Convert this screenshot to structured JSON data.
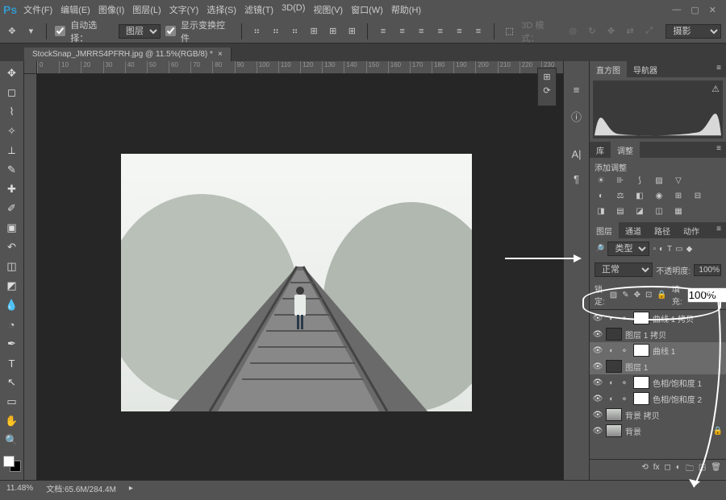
{
  "app": {
    "logo": "Ps"
  },
  "menu": [
    "文件(F)",
    "编辑(E)",
    "图像(I)",
    "图层(L)",
    "文字(Y)",
    "选择(S)",
    "滤镜(T)",
    "3D(D)",
    "视图(V)",
    "窗口(W)",
    "帮助(H)"
  ],
  "options": {
    "auto_select_label": "自动选择：",
    "auto_select_value": "图层",
    "transform_label": "显示变换控件",
    "mode3d_label": "3D 模式：",
    "right_dropdown": "摄影"
  },
  "document": {
    "tab_title": "StockSnap_JMRRS4PFRH.jpg @ 11.5%(RGB/8) *"
  },
  "ruler_marks": [
    "0",
    "10",
    "20",
    "30",
    "40",
    "50",
    "60",
    "70",
    "80",
    "90",
    "100",
    "110",
    "120",
    "130",
    "140",
    "150",
    "160",
    "170",
    "180",
    "190",
    "200",
    "210",
    "220",
    "230"
  ],
  "panels": {
    "hist_tabs": [
      "直方图",
      "导航器"
    ],
    "lib_tabs": [
      "库",
      "调整"
    ],
    "adj_title": "添加调整",
    "layer_tabs": [
      "图层",
      "通道",
      "路径",
      "动作"
    ],
    "filter_label": "类型",
    "blend_mode": "正常",
    "opacity_label": "不透明度:",
    "opacity_val": "100%",
    "lock_label": "锁定:",
    "fill_label": "填充:",
    "fill_val": "100%"
  },
  "layers": [
    {
      "name": "曲线 1 拷贝",
      "kind": "adj",
      "icon": "curves"
    },
    {
      "name": "图层 1 拷贝",
      "kind": "pixel"
    },
    {
      "name": "曲线 1",
      "kind": "adj",
      "icon": "curves",
      "sel": true
    },
    {
      "name": "图层 1",
      "kind": "pixel",
      "sel": true
    },
    {
      "name": "色相/饱和度 1",
      "kind": "adj",
      "icon": "hue"
    },
    {
      "name": "色相/饱和度 2",
      "kind": "adj",
      "icon": "hue",
      "masked": true
    },
    {
      "name": "背景 拷贝",
      "kind": "image"
    },
    {
      "name": "背景",
      "kind": "image",
      "locked": true
    }
  ],
  "status": {
    "zoom": "11.48%",
    "docinfo_label": "文档:",
    "docinfo": "65.6M/284.4M"
  },
  "tools": [
    "↔",
    "▭",
    "◌",
    "✁",
    "✎",
    "◢",
    "✐",
    "✦",
    "⧉",
    "⌫",
    "◍",
    "◐",
    "▲",
    "✎",
    "T",
    "↖",
    "□",
    "✋",
    "🔍"
  ]
}
